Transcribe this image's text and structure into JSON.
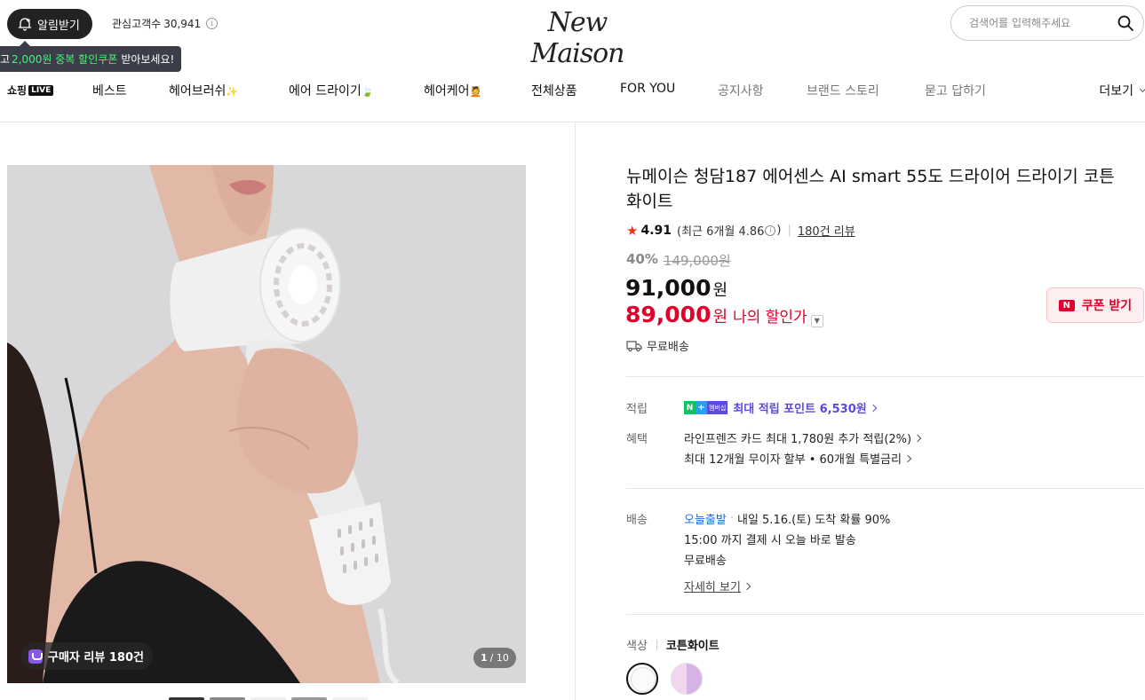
{
  "header": {
    "notify_label": "알림받기",
    "fans_label": "관심고객수",
    "fans_count": "30,941",
    "info_glyph": "i",
    "tooltip": {
      "prefix": "고",
      "highlight": "2,000원 중복 할인쿠폰",
      "suffix": "받아보세요!"
    },
    "logo": "New Maison",
    "search_placeholder": "검색어를 입력해주세요"
  },
  "nav": {
    "live_logo": "쇼핑",
    "live_tag": "LIVE",
    "items": [
      {
        "label": "베스트",
        "emoji": ""
      },
      {
        "label": "헤어브러쉬",
        "emoji": "✨"
      },
      {
        "label": "에어 드라이기",
        "emoji": "🍃"
      },
      {
        "label": "헤어케어",
        "emoji": "💆"
      },
      {
        "label": "전체상품",
        "emoji": ""
      },
      {
        "label": "FOR YOU",
        "emoji": ""
      },
      {
        "label": "공지사항",
        "emoji": ""
      },
      {
        "label": "브랜드 스토리",
        "emoji": ""
      },
      {
        "label": "묻고 답하기",
        "emoji": ""
      }
    ],
    "more_label": "더보기"
  },
  "gallery": {
    "review_badge": "구매자 리뷰 180건",
    "current_page": "1",
    "total_pages": "/ 10",
    "thumbnail_count": 5
  },
  "product": {
    "title": "뉴메이슨 청담187 에어센스 AI smart 55도 드라이어 드라이기 코튼화이트",
    "rating": {
      "score": "4.91",
      "recent_label": "(최근 6개월 4.86",
      "recent_close": ")",
      "review_link": "180건 리뷰"
    },
    "discount_pct": "40%",
    "original_price": "149,000원",
    "price": "91,000",
    "price_unit": "원",
    "my_price": "89,000",
    "my_price_unit": "원",
    "my_price_label": "나의 할인가",
    "coupon_button": "쿠폰 받기",
    "coupon_icon": "N",
    "free_shipping": "무료배송"
  },
  "benefits": {
    "points_label": "적립",
    "points_badge": {
      "n": "N",
      "plus": "+",
      "member": "멤버십"
    },
    "points_text": "최대 적립 포인트 6,530원",
    "benefit_label": "혜택",
    "benefit_line1": "라인프렌즈 카드 최대 1,780원 추가 적립(2%)",
    "benefit_line2": "최대 12개월 무이자 할부 • 60개월 특별금리"
  },
  "delivery": {
    "label": "배송",
    "today_label": "오늘출발",
    "line1": "내일 5.16.(토) 도착 확률 90%",
    "line2": "15:00 까지 결제 시 오늘 바로 발송",
    "line3": "무료배송",
    "details_link": "자세히 보기"
  },
  "options": {
    "color_label": "색상",
    "color_value": "코튼화이트",
    "swatches": [
      "코튼화이트",
      "라벤더"
    ]
  },
  "colors": {
    "accent_red": "#e0002b",
    "points_purple": "#5b49e0",
    "today_blue": "#1b6ad8",
    "naver_green": "#0fc35d"
  }
}
